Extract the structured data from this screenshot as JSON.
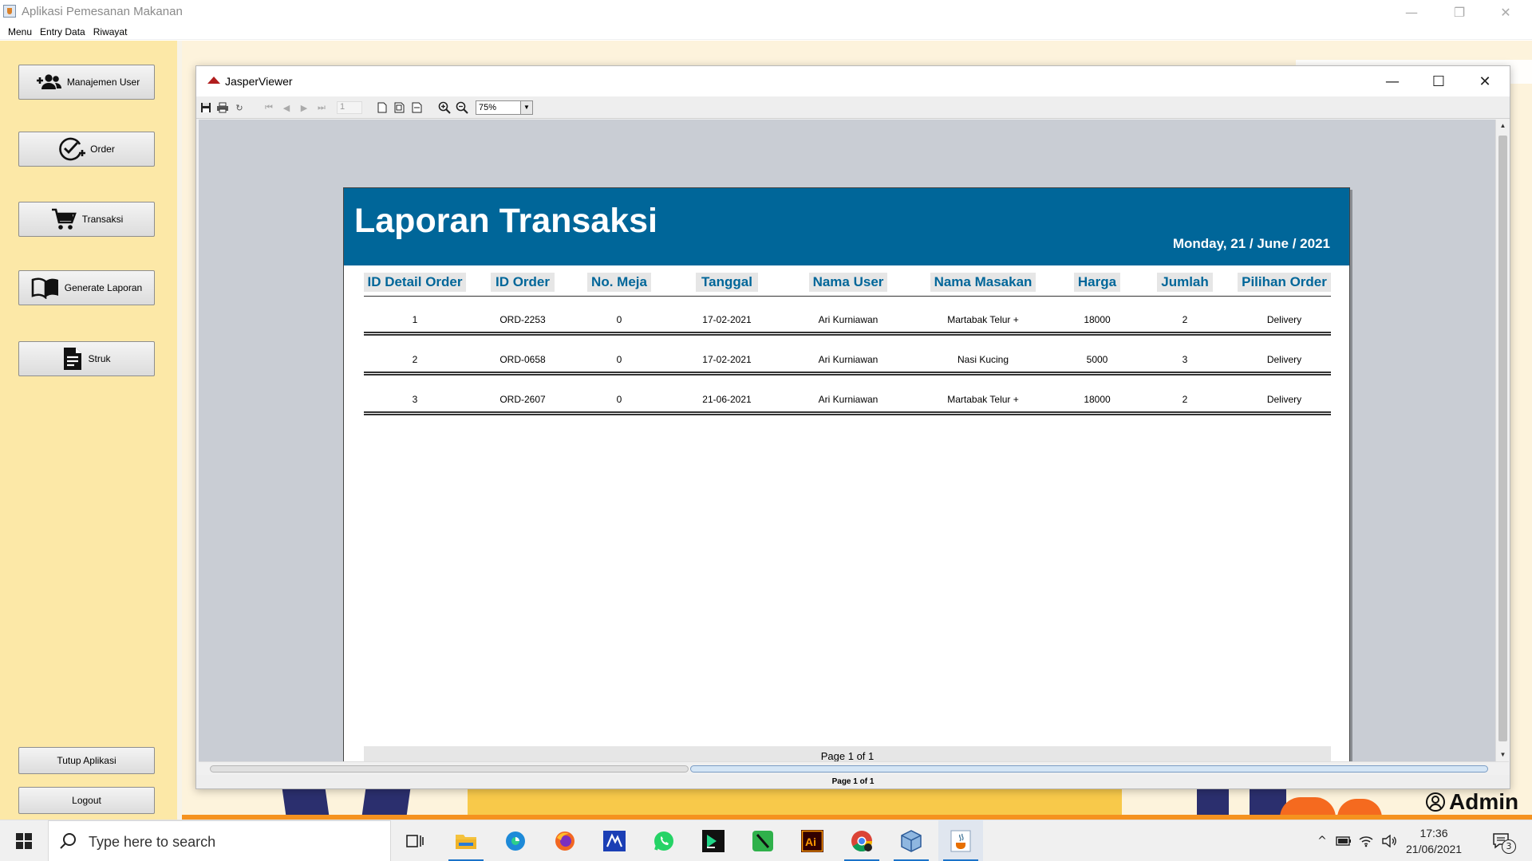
{
  "app": {
    "title": "Aplikasi Pemesanan Makanan",
    "menu": [
      "Menu",
      "Entry Data",
      "Riwayat"
    ],
    "window_controls": {
      "minimize": "—",
      "restore": "❐",
      "close": "✕"
    }
  },
  "sidebar": {
    "buttons": [
      {
        "label": "Manajemen User",
        "icon": "add-users-icon"
      },
      {
        "label": "Order",
        "icon": "order-check-icon"
      },
      {
        "label": "Transaksi",
        "icon": "cart-icon"
      },
      {
        "label": "Generate Laporan",
        "icon": "book-icon"
      },
      {
        "label": "Struk",
        "icon": "document-icon"
      }
    ],
    "bottom_buttons": [
      "Tutup Aplikasi",
      "Logout"
    ]
  },
  "background": {
    "admin_label": "Admin"
  },
  "jasper": {
    "title": "JasperViewer",
    "window_controls": {
      "minimize": "—",
      "maximize": "☐",
      "close": "✕"
    },
    "toolbar": {
      "page_number": "1",
      "zoom": "75%"
    },
    "status": "Page 1 of 1"
  },
  "report": {
    "title": "Laporan Transaksi",
    "date": "Monday, 21 / June / 2021",
    "columns": [
      "ID Detail Order",
      "ID Order",
      "No. Meja",
      "Tanggal",
      "Nama User",
      "Nama Masakan",
      "Harga",
      "Jumlah",
      "Pilihan Order"
    ],
    "rows": [
      [
        "1",
        "ORD-2253",
        "0",
        "17-02-2021",
        "Ari Kurniawan",
        "Martabak Telur +",
        "18000",
        "2",
        "Delivery"
      ],
      [
        "2",
        "ORD-0658",
        "0",
        "17-02-2021",
        "Ari Kurniawan",
        "Nasi Kucing",
        "5000",
        "3",
        "Delivery"
      ],
      [
        "3",
        "ORD-2607",
        "0",
        "21-06-2021",
        "Ari Kurniawan",
        "Martabak Telur +",
        "18000",
        "2",
        "Delivery"
      ]
    ],
    "footer": "Page 1 of 1",
    "header_color": "#006699"
  },
  "taskbar": {
    "search_placeholder": "Type here to search",
    "time": "17:36",
    "date": "21/06/2021",
    "notification_count": "3",
    "apps": [
      "task-view",
      "file-explorer",
      "edge",
      "firefox",
      "meta-app",
      "whatsapp",
      "jetbrains",
      "notepad-plus",
      "illustrator",
      "chrome",
      "virtualbox",
      "java"
    ]
  }
}
